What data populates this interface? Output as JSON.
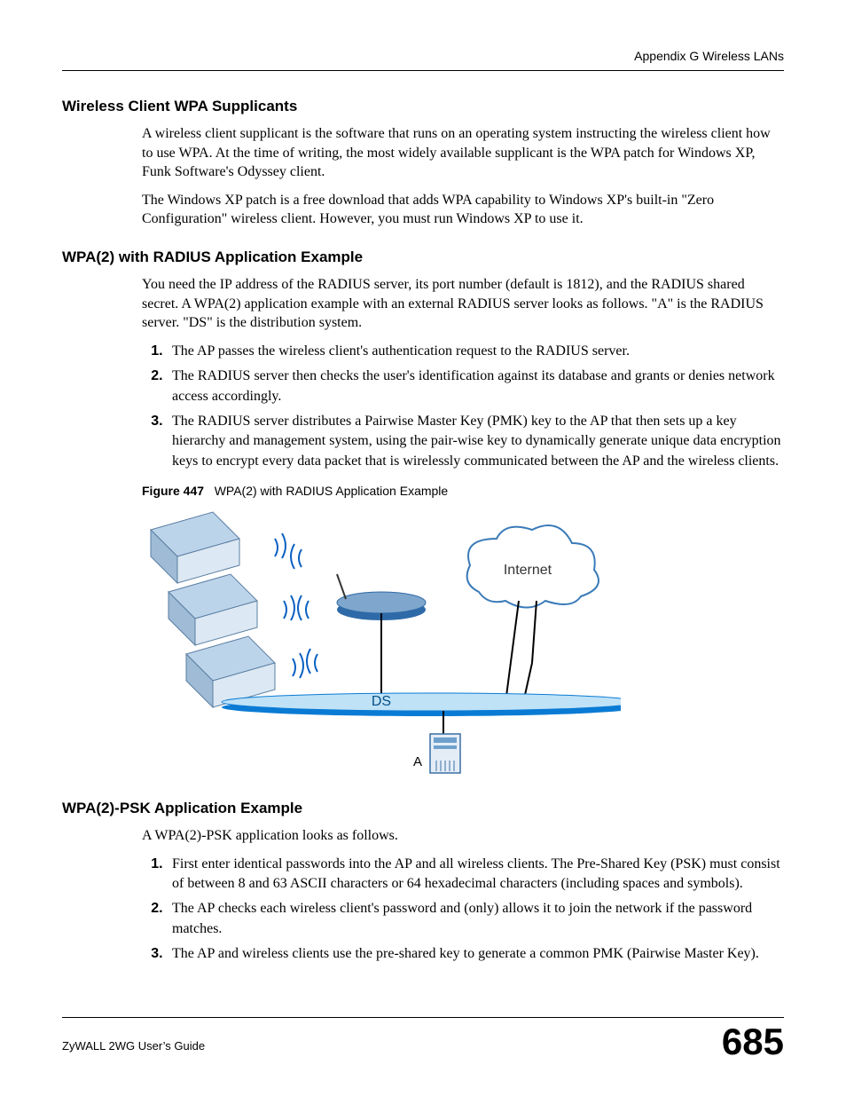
{
  "header": "Appendix G Wireless LANs",
  "section1": {
    "title": "Wireless Client WPA Supplicants",
    "p1": "A wireless client supplicant is the software that runs on an operating system instructing the wireless client how to use WPA. At the time of writing, the most widely available supplicant is the WPA patch for Windows XP, Funk Software's Odyssey client.",
    "p2": "The Windows XP patch is a free download that adds WPA capability to Windows XP's built-in \"Zero Configuration\" wireless client. However, you must run Windows XP to use it."
  },
  "section2": {
    "title": "WPA(2) with RADIUS Application Example",
    "p1": "You need the IP address of the RADIUS server, its port number (default is 1812), and the RADIUS shared secret. A WPA(2) application example with an external RADIUS server looks as follows. \"A\" is the RADIUS server. \"DS\" is the distribution system.",
    "li1": "The AP passes the wireless client's authentication request to the RADIUS server.",
    "li2": "The RADIUS server then checks the user's identification against its database and grants or denies network access accordingly.",
    "li3": "The RADIUS server distributes a Pairwise Master Key (PMK) key to the AP that then sets up a key hierarchy and management system, using the pair-wise key to dynamically generate unique data encryption keys to encrypt every data packet that is wirelessly communicated between the AP and the wireless clients.",
    "figcap_num": "Figure 447",
    "figcap_txt": "WPA(2) with RADIUS Application Example",
    "diagram": {
      "internet": "Internet",
      "ds": "DS",
      "a": "A"
    }
  },
  "section3": {
    "title": "WPA(2)-PSK Application Example",
    "p1": "A WPA(2)-PSK application looks as follows.",
    "li1": "First enter identical passwords into the AP and all wireless clients. The Pre-Shared Key (PSK) must consist of between 8 and 63 ASCII characters or 64 hexadecimal characters (including spaces and symbols).",
    "li2": "The AP checks each wireless client's password and (only) allows it to join the network if the password matches.",
    "li3": "The AP and wireless clients use the pre-shared key to generate a common PMK (Pairwise Master Key)."
  },
  "footer": {
    "guide": "ZyWALL 2WG User’s Guide",
    "page": "685"
  }
}
